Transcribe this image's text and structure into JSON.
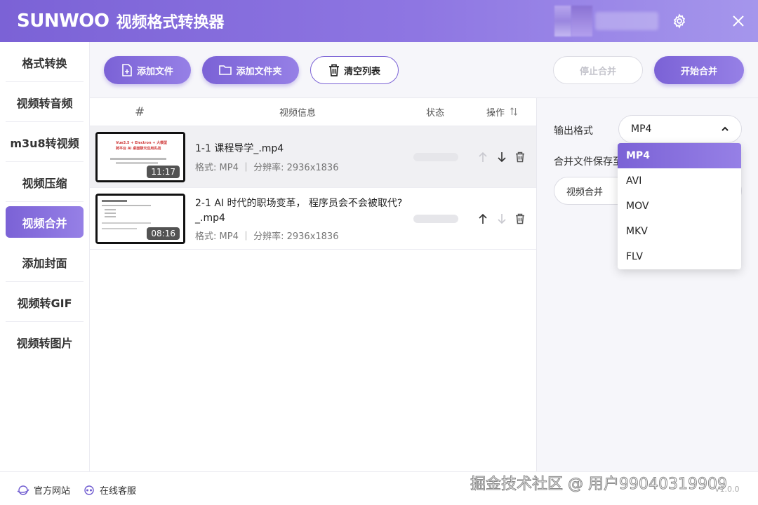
{
  "window": {
    "brand": "SUNWOO",
    "title": "视频格式转换器"
  },
  "sidebar": {
    "items": [
      {
        "label": "格式转换"
      },
      {
        "label": "视频转音频"
      },
      {
        "label": "m3u8转视频"
      },
      {
        "label": "视频压缩"
      },
      {
        "label": "视频合并",
        "active": true
      },
      {
        "label": "添加封面"
      },
      {
        "label": "视频转GIF"
      },
      {
        "label": "视频转图片"
      }
    ]
  },
  "toolbar": {
    "add_file": "添加文件",
    "add_folder": "添加文件夹",
    "clear_list": "清空列表",
    "stop_merge": "停止合并",
    "start_merge": "开始合并"
  },
  "table": {
    "headers": {
      "index": "#",
      "info": "视频信息",
      "status": "状态",
      "ops": "操作"
    },
    "rows": [
      {
        "name": "1-1 课程导学_.mp4",
        "meta": "格式: MP4 ｜ 分辨率: 2936x1836",
        "duration": "11:17",
        "thumb_line1": "Vue3.5 + Electron + 大模型",
        "thumb_line2": "跨平台 AI 桌面聊天应用实战"
      },
      {
        "name_line1": "2-1 AI 时代的职场变革， 程序员会不会被取代?",
        "name_line2": "_.mp4",
        "meta": "格式: MP4 ｜ 分辨率: 2936x1836",
        "duration": "08:16"
      }
    ]
  },
  "right_panel": {
    "output_format_label": "输出格式",
    "output_format_value": "MP4",
    "save_label": "合并文件保存至",
    "save_path": "视频合并",
    "format_options": [
      "MP4",
      "AVI",
      "MOV",
      "MKV",
      "FLV"
    ]
  },
  "footer": {
    "website": "官方网站",
    "support": "在线客服",
    "version": "V1.0.0",
    "watermark": "掘金技术社区 @ 用户99040319909"
  },
  "colors": {
    "accent": "#7b62d6",
    "accent_light": "#9680e6"
  }
}
